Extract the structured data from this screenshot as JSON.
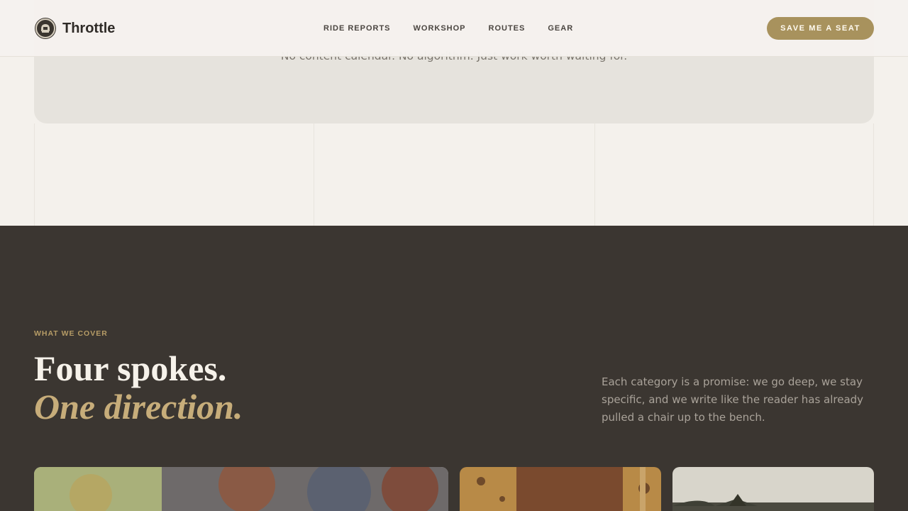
{
  "header": {
    "brand": "Throttle",
    "nav": [
      "RIDE REPORTS",
      "WORKSHOP",
      "ROUTES",
      "GEAR"
    ],
    "cta": "SAVE ME A SEAT",
    "logo_icon": "helmet-badge-icon"
  },
  "intro": {
    "tagline": "No content calendar. No algorithm. Just work worth waiting for."
  },
  "cover": {
    "eyebrow": "WHAT WE COVER",
    "headline_line1": "Four spokes.",
    "headline_line2": "One direction.",
    "description": "Each category is a promise: we go deep, we stay specific, and we write like the reader has already pulled a chair up to the bench.",
    "cards": [
      "autumn-trees-image",
      "workshop-detail-image",
      "misty-road-image"
    ]
  },
  "colors": {
    "accent": "#a8925d",
    "dark_bg": "#3b3631",
    "page_bg": "#f4f1ec"
  }
}
